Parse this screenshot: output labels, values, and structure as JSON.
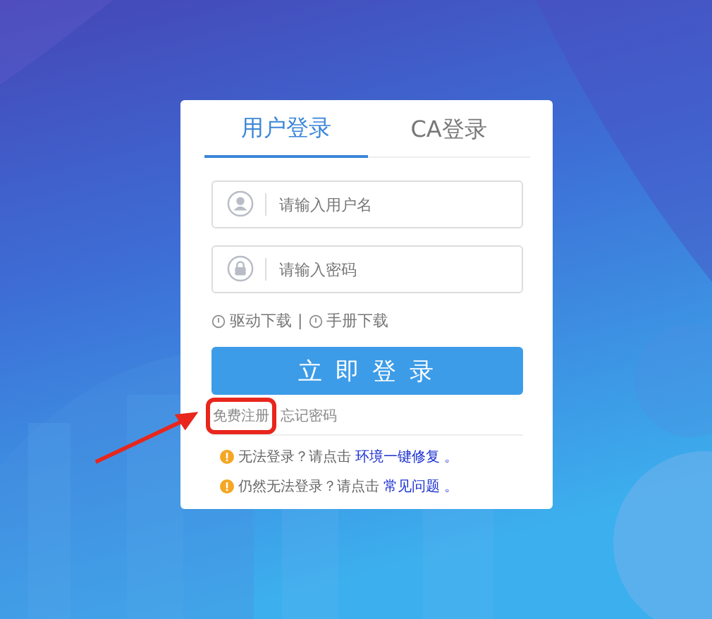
{
  "tabs": [
    {
      "label": "用户登录",
      "selected": true
    },
    {
      "label": "CA登录",
      "selected": false
    }
  ],
  "fields": [
    {
      "kind": "user",
      "placeholder": "请输入用户名"
    },
    {
      "kind": "lock",
      "placeholder": "请输入密码"
    }
  ],
  "downloads": [
    "驱动下载",
    "手册下载"
  ],
  "downloads_separator": "|",
  "login_button": "立 即 登 录",
  "links": [
    {
      "label": "免费注册",
      "highlighted": true
    },
    {
      "label": "忘记密码",
      "highlighted": false
    }
  ],
  "notes": [
    {
      "text": "无法登录？请点击",
      "link": "环境一键修复",
      "end": "。"
    },
    {
      "text": "仍然无法登录？请点击",
      "link": "常见问题",
      "end": "。"
    }
  ]
}
